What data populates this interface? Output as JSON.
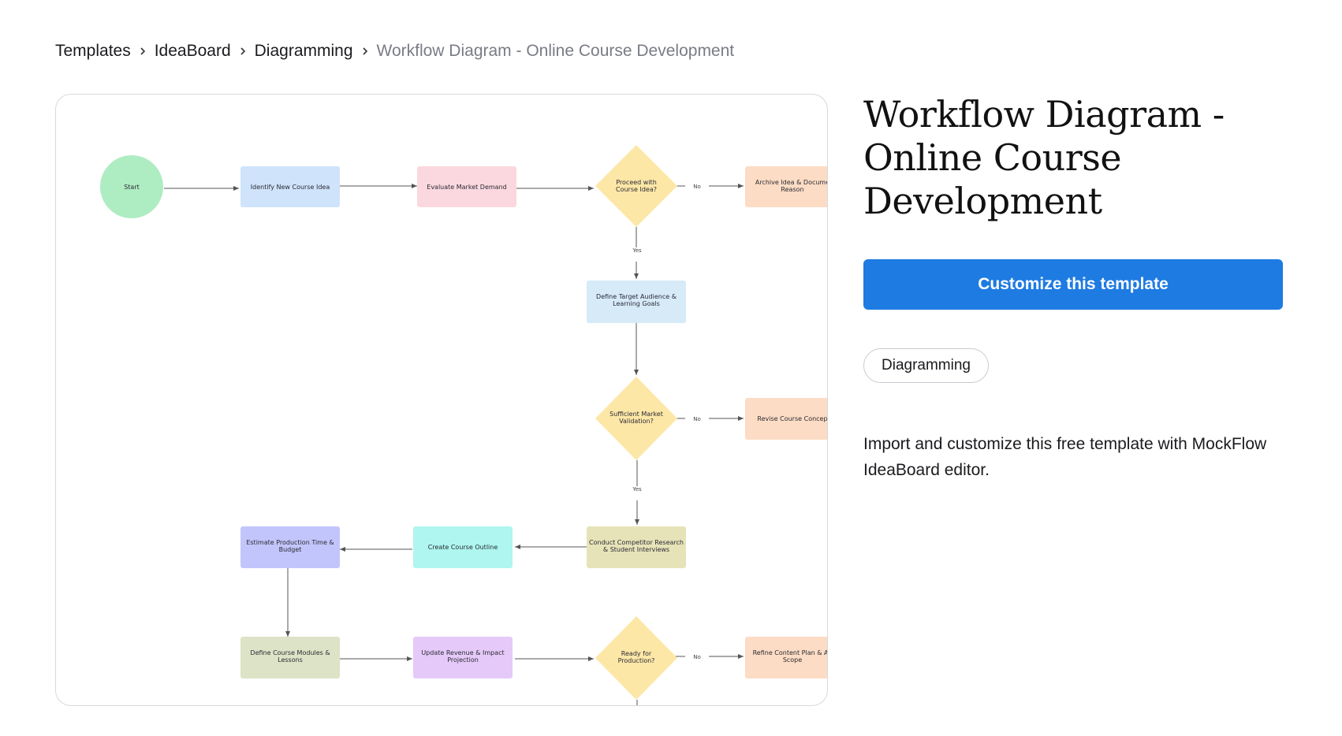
{
  "breadcrumb": {
    "items": [
      {
        "label": "Templates"
      },
      {
        "label": "IdeaBoard"
      },
      {
        "label": "Diagramming"
      },
      {
        "label": "Workflow Diagram - Online Course Development"
      }
    ],
    "separator_icon": "chevron-right-icon"
  },
  "page": {
    "title": "Workflow Diagram - Online Course Development",
    "cta_label": "Customize this template",
    "tag_label": "Diagramming",
    "description": "Import and customize this free template with MockFlow IdeaBoard editor.",
    "colors": {
      "cta_bg": "#1e7be2",
      "cta_text": "#ffffff",
      "crumb_current": "#7a7c85"
    }
  },
  "diagram": {
    "nodes": {
      "start": "Start",
      "identify": "Identify New Course Idea",
      "evaluate": "Evaluate Market Demand",
      "proceed_1": "Proceed with",
      "proceed_2": "Course Idea?",
      "archive_1": "Archive Idea & Docume",
      "archive_2": "Reason",
      "define_1": "Define Target Audience &",
      "define_2": "Learning Goals",
      "sufficient_1": "Sufficient Market",
      "sufficient_2": "Validation?",
      "revise": "Revise Course Concep",
      "conduct_1": "Conduct Competitor Research",
      "conduct_2": "& Student Interviews",
      "outline": "Create Course Outline",
      "estimate_1": "Estimate Production Time &",
      "estimate_2": "Budget",
      "modules_1": "Define Course Modules &",
      "modules_2": "Lessons",
      "revenue_1": "Update Revenue & Impact",
      "revenue_2": "Projection",
      "ready_1": "Ready for",
      "ready_2": "Production?",
      "refine_1": "Refine Content Plan & Ad",
      "refine_2": "Scope"
    },
    "edge_labels": {
      "no_1": "No",
      "yes_1": "Yes",
      "no_2": "No",
      "yes_2": "Yes",
      "no_3": "No"
    },
    "colors": {
      "start": "#aeecc2",
      "blue": "#cfe3fb",
      "pink": "#fbd8df",
      "yellow": "#fde7a7",
      "peach": "#fcdcc4",
      "lightblue": "#d6eaf8",
      "olive": "#e6e3b9",
      "cyan": "#aef6ef",
      "periwinkle": "#c2c5fb",
      "sage": "#dce3c6",
      "lilac": "#e5c9f9"
    }
  }
}
